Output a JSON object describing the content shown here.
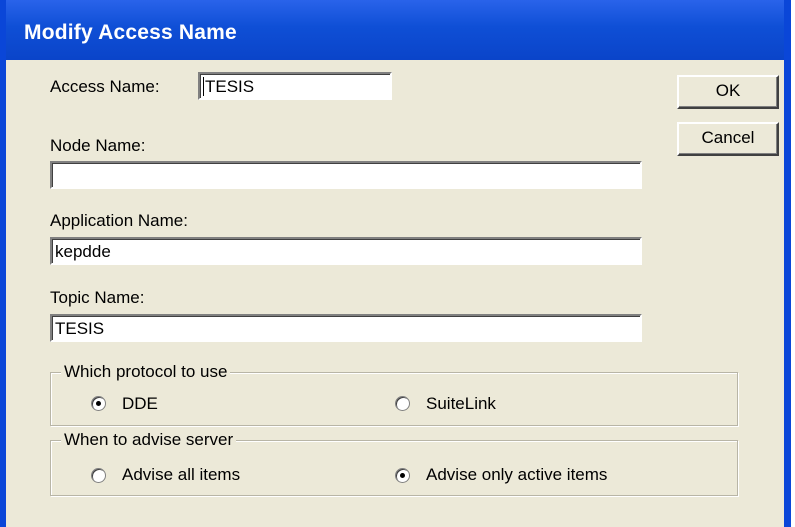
{
  "window": {
    "title": "Modify Access Name"
  },
  "fields": {
    "access_name": {
      "label": "Access Name:",
      "value": "TESIS"
    },
    "node_name": {
      "label": "Node Name:",
      "value": ""
    },
    "application_name": {
      "label": "Application Name:",
      "value": "kepdde"
    },
    "topic_name": {
      "label": "Topic Name:",
      "value": "TESIS"
    }
  },
  "buttons": {
    "ok": "OK",
    "cancel": "Cancel"
  },
  "protocol_group": {
    "legend": "Which protocol to use",
    "options": [
      {
        "label": "DDE",
        "selected": true
      },
      {
        "label": "SuiteLink",
        "selected": false
      }
    ]
  },
  "advise_group": {
    "legend": "When to advise server",
    "options": [
      {
        "label": "Advise all items",
        "selected": false
      },
      {
        "label": "Advise only active items",
        "selected": true
      }
    ]
  }
}
